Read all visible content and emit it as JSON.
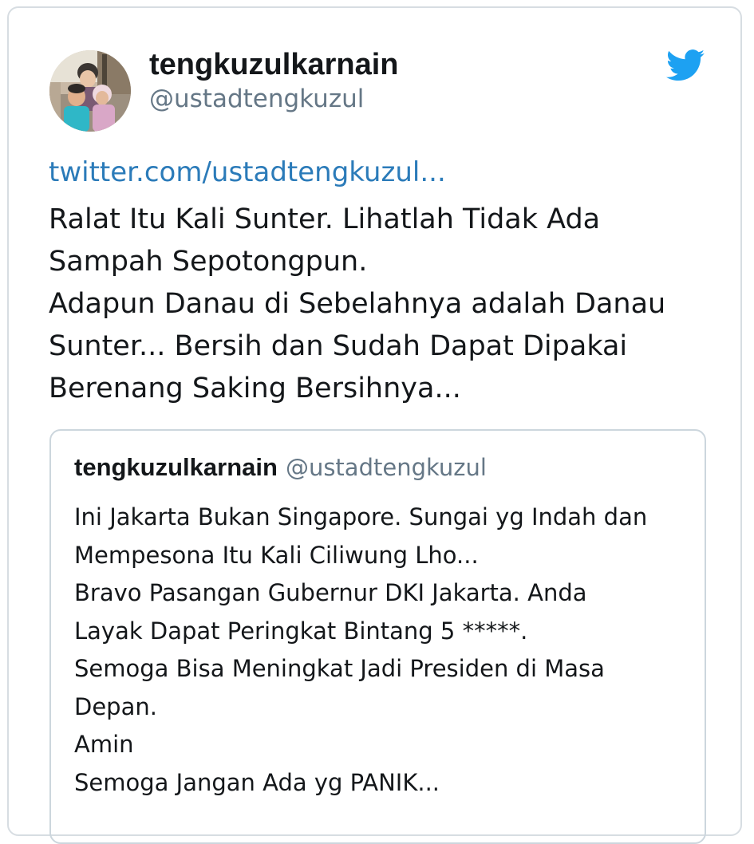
{
  "author": {
    "display_name": "tengkuzulkarnain",
    "handle": "@ustadtengkuzul",
    "avatar_icon": "family-photo-avatar"
  },
  "brand": {
    "icon": "twitter-bird-icon",
    "color": "#1da1f2"
  },
  "tweet": {
    "link": "twitter.com/ustadtengkuzul...",
    "lines": [
      "Ralat Itu Kali Sunter. Lihatlah Tidak Ada",
      "Sampah Sepotongpun.",
      "Adapun Danau di Sebelahnya adalah Danau",
      "Sunter... Bersih dan Sudah Dapat Dipakai",
      "Berenang Saking Bersihnya..."
    ]
  },
  "quoted_tweet": {
    "display_name": "tengkuzulkarnain",
    "handle": "@ustadtengkuzul",
    "lines": [
      "Ini Jakarta Bukan Singapore. Sungai yg Indah dan",
      "Mempesona Itu Kali Ciliwung Lho...",
      "Bravo Pasangan Gubernur DKI Jakarta. Anda",
      "Layak Dapat Peringkat Bintang 5 *****.",
      "Semoga Bisa Meningkat Jadi Presiden di Masa",
      "Depan.",
      "Amin",
      "Semoga Jangan Ada yg PANIK..."
    ]
  },
  "colors": {
    "link": "#2b7bb9",
    "text": "#14171a",
    "muted": "#657786",
    "border": "#ccd6dd"
  }
}
